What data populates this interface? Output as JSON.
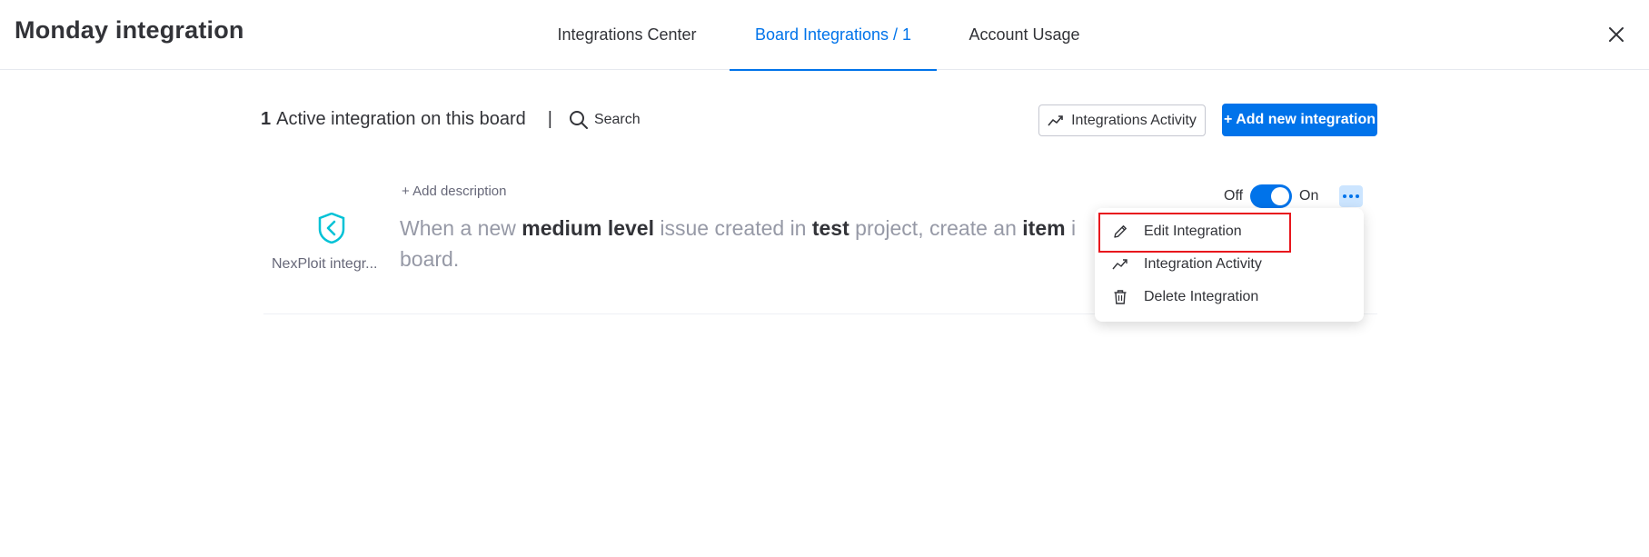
{
  "header": {
    "title": "Monday integration",
    "tabs": [
      {
        "label": "Integrations Center"
      },
      {
        "label": "Board Integrations / 1"
      },
      {
        "label": "Account Usage"
      }
    ],
    "active_tab": "Board Integrations / 1",
    "close_icon": "close-icon"
  },
  "toolbar": {
    "active_count": "1",
    "active_text": "Active integration on this board",
    "separator": "|",
    "search_label": "Search",
    "activity_button_label": "Integrations Activity",
    "add_button_label": "+ Add new integration"
  },
  "integration": {
    "add_description": "+ Add description",
    "app_name": "NexPloit integr...",
    "recipe_parts": [
      {
        "text": "When a new ",
        "bold": false
      },
      {
        "text": "medium level",
        "bold": true
      },
      {
        "text": " issue created in ",
        "bold": false
      },
      {
        "text": "test",
        "bold": true
      },
      {
        "text": " project, create an ",
        "bold": false
      },
      {
        "text": "item",
        "bold": true
      },
      {
        "text": " i",
        "bold": false
      },
      {
        "text": "board.",
        "bold": false
      }
    ],
    "toggle_off_label": "Off",
    "toggle_on_label": "On",
    "toggle_state": "on"
  },
  "menu": {
    "items": [
      {
        "label": "Edit Integration",
        "icon": "pencil-icon"
      },
      {
        "label": "Integration Activity",
        "icon": "trend-icon"
      },
      {
        "label": "Delete Integration",
        "icon": "trash-icon"
      }
    ]
  },
  "colors": {
    "accent": "#0073ea",
    "highlight": "#e8161d",
    "logo": "#00c2d6"
  }
}
